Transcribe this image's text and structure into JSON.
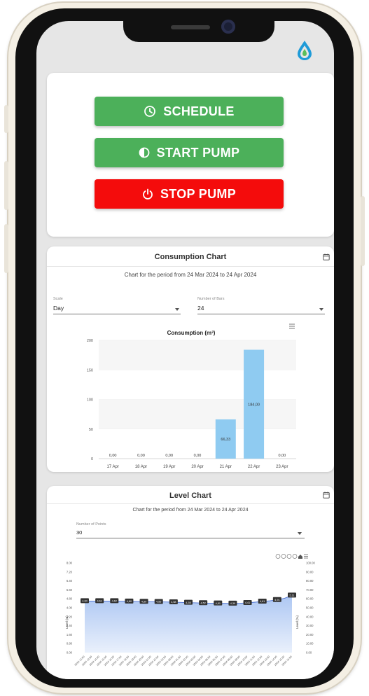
{
  "actions": {
    "schedule_label": "SCHEDULE",
    "start_label": "START PUMP",
    "stop_label": "STOP PUMP",
    "colors": {
      "schedule": "#4cb05a",
      "start": "#4cb05a",
      "stop": "#f40c0c"
    }
  },
  "consumption": {
    "card_title": "Consumption Chart",
    "period_text": "Chart for the period from 24 Mar 2024 to 24 Apr 2024",
    "scale_label": "Scale",
    "scale_value": "Day",
    "bars_label": "Number of Bars",
    "bars_value": "24",
    "chart_data": {
      "type": "bar",
      "title": "Consumption (m³)",
      "categories": [
        "17 Apr",
        "18 Apr",
        "19 Apr",
        "20 Apr",
        "21 Apr",
        "22 Apr",
        "23 Apr"
      ],
      "values": [
        0,
        0,
        0,
        0,
        66.33,
        184.0,
        0
      ],
      "data_labels": [
        "0,00",
        "0,00",
        "0,00",
        "0,00",
        "66,33",
        "184,00",
        "0,00"
      ],
      "ylim": [
        0,
        200
      ],
      "yticks": [
        "0",
        "50",
        "100",
        "150",
        "200"
      ],
      "bar_color": "#8fcbf1",
      "grid": true
    }
  },
  "level": {
    "card_title": "Level Chart",
    "period_text": "Chart for the period from 24 Mar 2024 to 24 Apr 2024",
    "points_label": "Number of Points",
    "points_value": "30",
    "chart_data": {
      "type": "area",
      "ylabel": "Level (m)",
      "y2label": "Level (%)",
      "ylim": [
        0,
        8
      ],
      "yticks": [
        "0.00",
        "0.80",
        "1.60",
        "2.40",
        "3.20",
        "4.00",
        "4.80",
        "5.60",
        "6.40",
        "7.20",
        "8.00"
      ],
      "y2ticks": [
        "0.00",
        "10.00",
        "20.00",
        "30.00",
        "40.00",
        "50.00",
        "60.00",
        "70.00",
        "80.00",
        "90.00",
        "100.00"
      ],
      "x": [
        "18/04 12:00",
        "18/04 13:00",
        "18/04 14:00",
        "18/04 15:00",
        "18/04 16:00",
        "18/04 17:00",
        "18/04 18:00",
        "18/04 19:00",
        "18/04 20:00",
        "18/04 21:00",
        "18/04 22:00",
        "18/04 23:00",
        "19/04 00:00",
        "19/04 01:00",
        "19/04 02:00",
        "19/04 03:00",
        "19/04 04:00",
        "19/04 05:00",
        "19/04 06:00",
        "19/04 07:00",
        "19/04 08:00",
        "19/04 09:00",
        "19/04 10:00",
        "19/04 11:00",
        "19/04 12:00",
        "19/04 13:00",
        "19/04 14:00",
        "19/04 15:00",
        "19/04 16:00"
      ],
      "values": [
        4.6,
        4.6,
        4.6,
        4.6,
        4.6,
        4.58,
        4.57,
        4.56,
        4.55,
        4.54,
        4.53,
        4.52,
        4.5,
        4.48,
        4.46,
        4.44,
        4.42,
        4.41,
        4.4,
        4.39,
        4.38,
        4.4,
        4.44,
        4.5,
        4.56,
        4.62,
        4.7,
        4.85,
        5.1
      ],
      "point_labels": [
        "4,60",
        "4,61",
        "4,62",
        "4,60",
        "4,59",
        "4,56",
        "4,58",
        "4,55",
        "4,52",
        "4,51",
        "4,39",
        "4,41",
        "4,61",
        "4,91",
        "5,11"
      ],
      "fill_color": "#a9c4f2",
      "toolbar_icons": [
        "zoom-in-icon",
        "zoom-out-icon",
        "magnify-icon",
        "pan-icon",
        "home-icon",
        "menu-icon"
      ]
    }
  }
}
